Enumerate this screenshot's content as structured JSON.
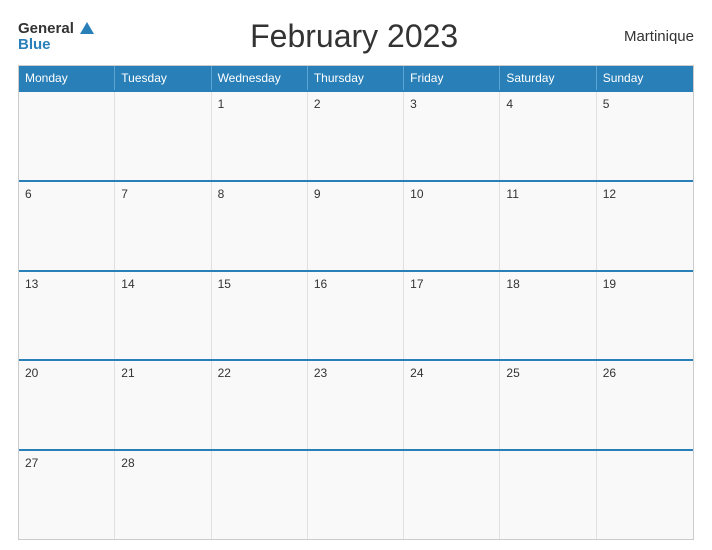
{
  "header": {
    "logo_general": "General",
    "logo_blue": "Blue",
    "title": "February 2023",
    "region": "Martinique"
  },
  "calendar": {
    "days_of_week": [
      "Monday",
      "Tuesday",
      "Wednesday",
      "Thursday",
      "Friday",
      "Saturday",
      "Sunday"
    ],
    "rows": [
      [
        {
          "day": "",
          "empty": true
        },
        {
          "day": "",
          "empty": true
        },
        {
          "day": "1",
          "empty": false
        },
        {
          "day": "2",
          "empty": false
        },
        {
          "day": "3",
          "empty": false
        },
        {
          "day": "4",
          "empty": false
        },
        {
          "day": "5",
          "empty": false
        }
      ],
      [
        {
          "day": "6",
          "empty": false
        },
        {
          "day": "7",
          "empty": false
        },
        {
          "day": "8",
          "empty": false
        },
        {
          "day": "9",
          "empty": false
        },
        {
          "day": "10",
          "empty": false
        },
        {
          "day": "11",
          "empty": false
        },
        {
          "day": "12",
          "empty": false
        }
      ],
      [
        {
          "day": "13",
          "empty": false
        },
        {
          "day": "14",
          "empty": false
        },
        {
          "day": "15",
          "empty": false
        },
        {
          "day": "16",
          "empty": false
        },
        {
          "day": "17",
          "empty": false
        },
        {
          "day": "18",
          "empty": false
        },
        {
          "day": "19",
          "empty": false
        }
      ],
      [
        {
          "day": "20",
          "empty": false
        },
        {
          "day": "21",
          "empty": false
        },
        {
          "day": "22",
          "empty": false
        },
        {
          "day": "23",
          "empty": false
        },
        {
          "day": "24",
          "empty": false
        },
        {
          "day": "25",
          "empty": false
        },
        {
          "day": "26",
          "empty": false
        }
      ],
      [
        {
          "day": "27",
          "empty": false
        },
        {
          "day": "28",
          "empty": false
        },
        {
          "day": "",
          "empty": true
        },
        {
          "day": "",
          "empty": true
        },
        {
          "day": "",
          "empty": true
        },
        {
          "day": "",
          "empty": true
        },
        {
          "day": "",
          "empty": true
        }
      ]
    ]
  }
}
